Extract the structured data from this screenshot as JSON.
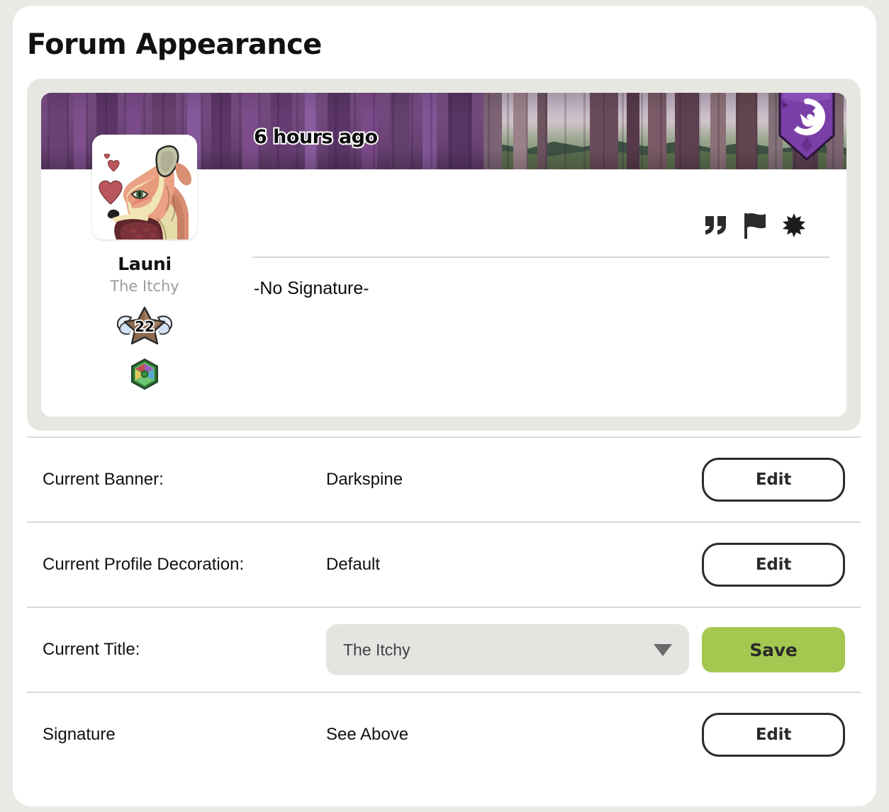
{
  "page": {
    "title": "Forum Appearance",
    "background_color": "#e9e9e5",
    "panel_color": "#ffffff"
  },
  "preview": {
    "timestamp": "6 hours ago",
    "username": "Launi",
    "user_title": "The Itchy",
    "signature_text": "-No Signature-",
    "level_badge": {
      "name": "winged-star-badge",
      "value": "22"
    },
    "gem_badge": {
      "name": "hex-gem-badge"
    },
    "banner": {
      "name": "Darkspine",
      "theme_color": "#6d4578"
    },
    "pennant": {
      "name": "spiral-pennant",
      "color": "#7b3fa8"
    },
    "post_icons": [
      {
        "name": "quote-icon",
        "label": "Quote"
      },
      {
        "name": "flag-icon",
        "label": "Report"
      },
      {
        "name": "sparkle-icon",
        "label": "React"
      }
    ]
  },
  "settings": {
    "rows": [
      {
        "label": "Current Banner:",
        "value": "Darkspine",
        "action": "Edit",
        "control": "button"
      },
      {
        "label": "Current Profile Decoration:",
        "value": "Default",
        "action": "Edit",
        "control": "button"
      },
      {
        "label": "Current Title:",
        "value": "The Itchy",
        "action": "Save",
        "control": "select"
      },
      {
        "label": "Signature",
        "value": "See Above",
        "action": "Edit",
        "control": "button"
      }
    ]
  },
  "colors": {
    "save_button": "#a4c84f",
    "select_background": "#e5e4e0",
    "divider": "#d8d8d8",
    "muted_text": "#9b9b9b"
  }
}
